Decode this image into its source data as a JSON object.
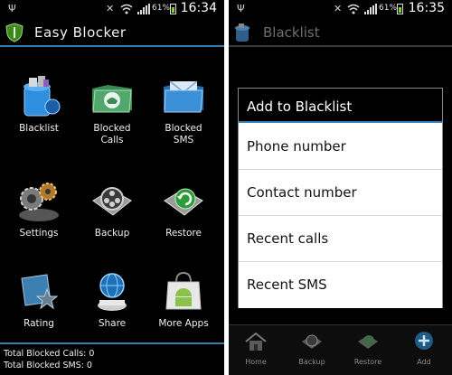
{
  "left_screen": {
    "status_bar": {
      "battery_percent": "61%",
      "time": "16:34",
      "icons": [
        "usb-icon",
        "mute-icon",
        "wifi-icon",
        "signal-icon",
        "battery-icon"
      ]
    },
    "app_title": "Easy Blocker",
    "grid": [
      {
        "label": "Blacklist",
        "icon": "trash-bin-icon"
      },
      {
        "label": "Blocked\nCalls",
        "icon": "phone-folder-icon"
      },
      {
        "label": "Blocked\nSMS",
        "icon": "mail-folder-icon"
      },
      {
        "label": "Settings",
        "icon": "gears-icon"
      },
      {
        "label": "Backup",
        "icon": "film-reel-icon"
      },
      {
        "label": "Restore",
        "icon": "restore-icon"
      },
      {
        "label": "Rating",
        "icon": "star-rating-icon"
      },
      {
        "label": "Share",
        "icon": "globe-icon"
      },
      {
        "label": "More Apps",
        "icon": "shopping-bag-android-icon"
      }
    ],
    "footer": {
      "blocked_calls": "Total Blocked Calls: 0",
      "blocked_sms": "Total Blocked SMS: 0"
    }
  },
  "right_screen": {
    "status_bar": {
      "battery_percent": "61%",
      "time": "16:35",
      "icons": [
        "usb-icon",
        "mute-icon",
        "wifi-icon",
        "signal-icon",
        "battery-icon"
      ]
    },
    "title": "Blacklist",
    "dialog": {
      "title": "Add to Blacklist",
      "items": [
        "Phone number",
        "Contact number",
        "Recent calls",
        "Recent SMS"
      ]
    },
    "bottom_nav": [
      {
        "label": "Home",
        "icon": "home-icon"
      },
      {
        "label": "Backup",
        "icon": "backup-icon"
      },
      {
        "label": "Restore",
        "icon": "restore-icon"
      },
      {
        "label": "Add",
        "icon": "add-icon"
      }
    ]
  },
  "colors": {
    "accent": "#2d7fb4",
    "background": "#000000",
    "dialog_bg": "#ffffff"
  }
}
